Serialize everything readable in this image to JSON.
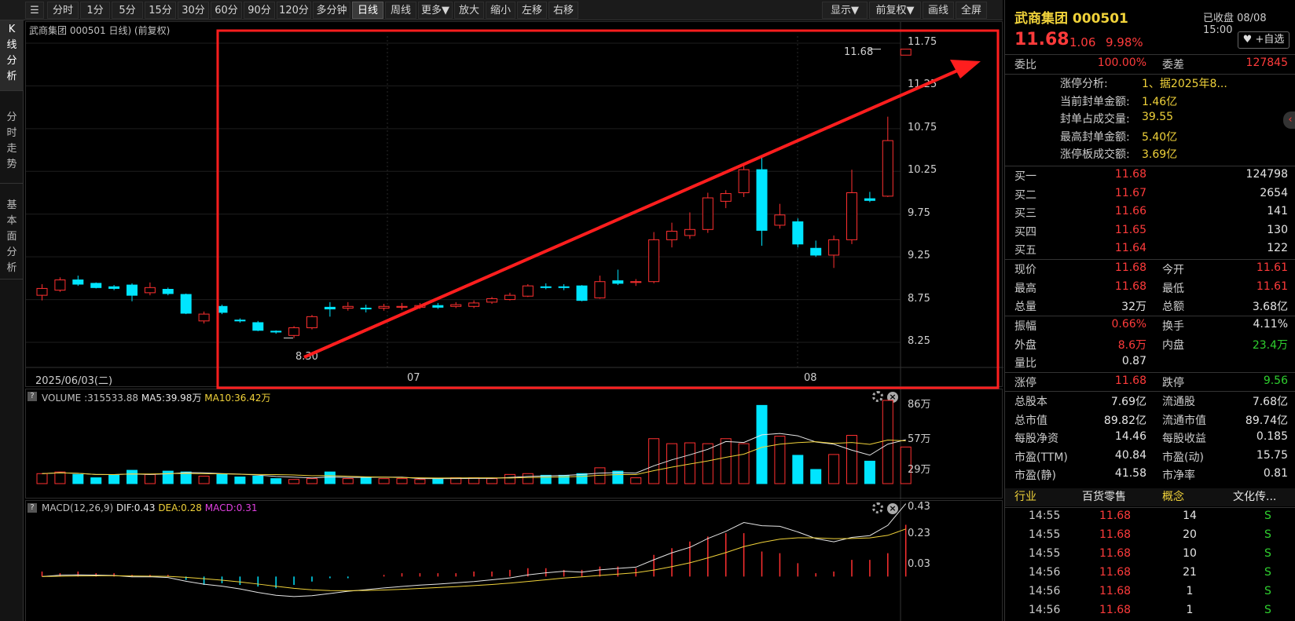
{
  "toolbar": {
    "left_items": [
      "分时",
      "1分",
      "5分",
      "15分",
      "30分",
      "60分",
      "90分",
      "120分",
      "多分钟",
      "日线",
      "周线",
      "更多▼",
      "放大",
      "缩小",
      "左移",
      "右移"
    ],
    "active": "日线",
    "right_items": [
      "显示▼",
      "前复权▼",
      "画线",
      "全屏"
    ]
  },
  "left_tabs": [
    "K线分析",
    "分时走势",
    "基本面分析"
  ],
  "kline": {
    "title": "武商集团 000501 日线) (前复权)",
    "date_start": "2025/06/03(二)",
    "month_labels": [
      "07",
      "08"
    ],
    "price_ticks": [
      "11.75",
      "11.25",
      "10.75",
      "10.25",
      "9.75",
      "9.25",
      "8.75",
      "8.25"
    ],
    "low_label": "8.30",
    "high_label": "11.68"
  },
  "volume": {
    "title": "VOLUME",
    "value": ":315533.88",
    "ma5": "MA5:39.98万",
    "ma10": "MA10:36.42万",
    "ticks": [
      "86万",
      "57万",
      "29万"
    ],
    "colors": {
      "ma5": "#e6e6e6",
      "ma10": "#f0d23a"
    }
  },
  "macd": {
    "title": "MACD(12,26,9)",
    "dif": "DIF:0.43",
    "dea": "DEA:0.28",
    "macd": "MACD:0.31",
    "ticks": [
      "0.43",
      "0.23",
      "0.03"
    ],
    "colors": {
      "dif": "#e6e6e6",
      "dea": "#f0d23a",
      "macd": "#e040e0"
    }
  },
  "candles": [
    {
      "o": 8.8,
      "c": 8.88,
      "h": 8.93,
      "l": 8.74
    },
    {
      "o": 8.86,
      "c": 8.98,
      "h": 9.01,
      "l": 8.84
    },
    {
      "o": 8.98,
      "c": 8.93,
      "h": 9.03,
      "l": 8.91
    },
    {
      "o": 8.94,
      "c": 8.89,
      "h": 8.95,
      "l": 8.88
    },
    {
      "o": 8.9,
      "c": 8.88,
      "h": 8.92,
      "l": 8.86
    },
    {
      "o": 8.92,
      "c": 8.8,
      "h": 8.94,
      "l": 8.73
    },
    {
      "o": 8.83,
      "c": 8.89,
      "h": 8.95,
      "l": 8.8
    },
    {
      "o": 8.87,
      "c": 8.82,
      "h": 8.89,
      "l": 8.8
    },
    {
      "o": 8.81,
      "c": 8.59,
      "h": 8.82,
      "l": 8.58
    },
    {
      "o": 8.5,
      "c": 8.58,
      "h": 8.61,
      "l": 8.47
    },
    {
      "o": 8.67,
      "c": 8.6,
      "h": 8.69,
      "l": 8.58
    },
    {
      "o": 8.51,
      "c": 8.5,
      "h": 8.53,
      "l": 8.48
    },
    {
      "o": 8.48,
      "c": 8.39,
      "h": 8.5,
      "l": 8.38
    },
    {
      "o": 8.38,
      "c": 8.37,
      "h": 8.39,
      "l": 8.35
    },
    {
      "o": 8.33,
      "c": 8.42,
      "h": 8.44,
      "l": 8.3
    },
    {
      "o": 8.42,
      "c": 8.55,
      "h": 8.57,
      "l": 8.4
    },
    {
      "o": 8.66,
      "c": 8.64,
      "h": 8.72,
      "l": 8.55
    },
    {
      "o": 8.65,
      "c": 8.67,
      "h": 8.72,
      "l": 8.62
    },
    {
      "o": 8.65,
      "c": 8.64,
      "h": 8.69,
      "l": 8.6
    },
    {
      "o": 8.65,
      "c": 8.67,
      "h": 8.7,
      "l": 8.62
    },
    {
      "o": 8.66,
      "c": 8.67,
      "h": 8.71,
      "l": 8.63
    },
    {
      "o": 8.66,
      "c": 8.68,
      "h": 8.71,
      "l": 8.64
    },
    {
      "o": 8.68,
      "c": 8.66,
      "h": 8.71,
      "l": 8.64
    },
    {
      "o": 8.67,
      "c": 8.69,
      "h": 8.72,
      "l": 8.65
    },
    {
      "o": 8.67,
      "c": 8.71,
      "h": 8.74,
      "l": 8.65
    },
    {
      "o": 8.72,
      "c": 8.76,
      "h": 8.78,
      "l": 8.7
    },
    {
      "o": 8.75,
      "c": 8.8,
      "h": 8.83,
      "l": 8.74
    },
    {
      "o": 8.79,
      "c": 8.91,
      "h": 8.93,
      "l": 8.78
    },
    {
      "o": 8.9,
      "c": 8.89,
      "h": 8.94,
      "l": 8.87
    },
    {
      "o": 8.9,
      "c": 8.89,
      "h": 8.93,
      "l": 8.86
    },
    {
      "o": 8.91,
      "c": 8.74,
      "h": 8.92,
      "l": 8.73
    },
    {
      "o": 8.77,
      "c": 8.96,
      "h": 9.03,
      "l": 8.76
    },
    {
      "o": 8.97,
      "c": 8.94,
      "h": 9.1,
      "l": 8.92
    },
    {
      "o": 8.95,
      "c": 8.96,
      "h": 8.99,
      "l": 8.91
    },
    {
      "o": 8.96,
      "c": 9.45,
      "h": 9.54,
      "l": 8.94
    },
    {
      "o": 9.45,
      "c": 9.55,
      "h": 9.65,
      "l": 9.36
    },
    {
      "o": 9.5,
      "c": 9.57,
      "h": 9.77,
      "l": 9.46
    },
    {
      "o": 9.57,
      "c": 9.94,
      "h": 10.0,
      "l": 9.53
    },
    {
      "o": 9.9,
      "c": 9.99,
      "h": 10.03,
      "l": 9.82
    },
    {
      "o": 10.0,
      "c": 10.27,
      "h": 10.33,
      "l": 9.95
    },
    {
      "o": 10.27,
      "c": 9.56,
      "h": 10.44,
      "l": 9.38
    },
    {
      "o": 9.62,
      "c": 9.74,
      "h": 9.87,
      "l": 9.58
    },
    {
      "o": 9.66,
      "c": 9.4,
      "h": 9.7,
      "l": 9.36
    },
    {
      "o": 9.35,
      "c": 9.27,
      "h": 9.44,
      "l": 9.25
    },
    {
      "o": 9.27,
      "c": 9.45,
      "h": 9.5,
      "l": 9.12
    },
    {
      "o": 9.45,
      "c": 10.0,
      "h": 10.27,
      "l": 9.4
    },
    {
      "o": 9.93,
      "c": 9.91,
      "h": 10.01,
      "l": 9.89
    },
    {
      "o": 9.96,
      "c": 10.61,
      "h": 10.89,
      "l": 9.95
    },
    {
      "o": 11.61,
      "c": 11.68,
      "h": 11.68,
      "l": 11.61
    }
  ],
  "vol_values": [
    12,
    14,
    11,
    7,
    10,
    16,
    11,
    15,
    14,
    9,
    11,
    8,
    9,
    6,
    5,
    6,
    14,
    6,
    7,
    6,
    6,
    5,
    6,
    7,
    7,
    6,
    11,
    12,
    10,
    10,
    12,
    19,
    15,
    7,
    54,
    48,
    49,
    48,
    54,
    48,
    94,
    57,
    34,
    17,
    35,
    58,
    27,
    100,
    44
  ],
  "macd_bars": [
    0.03,
    0.02,
    0.03,
    0.02,
    0.02,
    0.01,
    0.01,
    0.01,
    -0.02,
    -0.05,
    -0.04,
    -0.05,
    -0.06,
    -0.07,
    -0.05,
    -0.03,
    -0.01,
    -0.01,
    0.0,
    0.01,
    0.02,
    0.02,
    0.02,
    0.02,
    0.03,
    0.03,
    0.04,
    0.05,
    0.05,
    0.04,
    0.04,
    0.06,
    0.06,
    0.05,
    0.13,
    0.17,
    0.21,
    0.24,
    0.26,
    0.26,
    0.15,
    0.14,
    0.08,
    0.02,
    0.03,
    0.1,
    0.1,
    0.14,
    0.31
  ],
  "right": {
    "name": "武商集团 000501",
    "status": "已收盘 08/08 15:00",
    "price": "11.68",
    "change": "1.06",
    "pct": "9.98%",
    "fav": "+自选",
    "weibi_label": "委比",
    "weibi": "100.00%",
    "weicha_label": "委差",
    "weicha": "127845",
    "limit_info": [
      {
        "k": "涨停分析:",
        "v": "1、据2025年8..."
      },
      {
        "k": "当前封单金额:",
        "v": "1.46亿"
      },
      {
        "k": "封单占成交量:",
        "v": "39.55"
      },
      {
        "k": "最高封单金额:",
        "v": "5.40亿"
      },
      {
        "k": "涨停板成交额:",
        "v": "3.69亿"
      }
    ],
    "buys": [
      {
        "k": "买一",
        "p": "11.68",
        "v": "124798"
      },
      {
        "k": "买二",
        "p": "11.67",
        "v": "2654"
      },
      {
        "k": "买三",
        "p": "11.66",
        "v": "141"
      },
      {
        "k": "买四",
        "p": "11.65",
        "v": "130"
      },
      {
        "k": "买五",
        "p": "11.64",
        "v": "122"
      }
    ],
    "stats1": [
      {
        "k1": "现价",
        "v1": "11.68",
        "c1": "red",
        "k2": "今开",
        "v2": "11.61",
        "c2": "red"
      },
      {
        "k1": "最高",
        "v1": "11.68",
        "c1": "red",
        "k2": "最低",
        "v2": "11.61",
        "c2": "red"
      },
      {
        "k1": "总量",
        "v1": "32万",
        "c1": "white",
        "k2": "总额",
        "v2": "3.68亿",
        "c2": "white"
      }
    ],
    "stats2": [
      {
        "k1": "振幅",
        "v1": "0.66%",
        "c1": "red",
        "k2": "换手",
        "v2": "4.11%",
        "c2": "white"
      },
      {
        "k1": "外盘",
        "v1": "8.6万",
        "c1": "red",
        "k2": "内盘",
        "v2": "23.4万",
        "c2": "green"
      },
      {
        "k1": "量比",
        "v1": "0.87",
        "c1": "white",
        "k2": "",
        "v2": "",
        "c2": "white"
      }
    ],
    "stats3": [
      {
        "k1": "涨停",
        "v1": "11.68",
        "c1": "red",
        "k2": "跌停",
        "v2": "9.56",
        "c2": "green"
      }
    ],
    "stats4": [
      {
        "k1": "总股本",
        "v1": "7.69亿",
        "c1": "white",
        "k2": "流通股",
        "v2": "7.68亿",
        "c2": "white"
      },
      {
        "k1": "总市值",
        "v1": "89.82亿",
        "c1": "white",
        "k2": "流通市值",
        "v2": "89.74亿",
        "c2": "white"
      },
      {
        "k1": "每股净资",
        "v1": "14.46",
        "c1": "white",
        "k2": "每股收益",
        "v2": "0.185",
        "c2": "white"
      },
      {
        "k1": "市盈(TTM)",
        "v1": "40.84",
        "c1": "white",
        "k2": "市盈(动)",
        "v2": "15.75",
        "c2": "white"
      },
      {
        "k1": "市盈(静)",
        "v1": "41.58",
        "c1": "white",
        "k2": "市净率",
        "v2": "0.81",
        "c2": "white"
      }
    ],
    "industry": {
      "k1": "行业",
      "v1": "百货零售",
      "k2": "概念",
      "v2": "文化传..."
    },
    "ticks": [
      {
        "t": "14:55",
        "p": "11.68",
        "v": "14",
        "s": "S"
      },
      {
        "t": "14:55",
        "p": "11.68",
        "v": "20",
        "s": "S"
      },
      {
        "t": "14:55",
        "p": "11.68",
        "v": "10",
        "s": "S"
      },
      {
        "t": "14:56",
        "p": "11.68",
        "v": "21",
        "s": "S"
      },
      {
        "t": "14:56",
        "p": "11.68",
        "v": "1",
        "s": "S"
      },
      {
        "t": "14:56",
        "p": "11.68",
        "v": "1",
        "s": "S"
      }
    ]
  }
}
